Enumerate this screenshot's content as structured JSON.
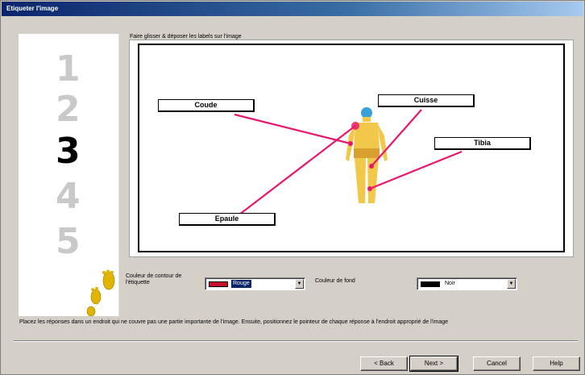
{
  "window": {
    "title": "Etiqueter l'image"
  },
  "steps": [
    "1",
    "2",
    "3",
    "4",
    "5"
  ],
  "current_step": 3,
  "instruction_top": "Faire glisser & déposer les labels sur l'image",
  "labels": [
    "Coude",
    "Cuisse",
    "Tibia",
    "Epaule"
  ],
  "form": {
    "contour_label": "Couleur de contour de l'étiquette",
    "contour_value": "Rouge",
    "contour_color": "#c8102e",
    "fond_label": "Couleur de fond",
    "fond_value": "Noir",
    "fond_color": "#000000"
  },
  "instruction_bottom": "Placez les réponses dans un endroit qui ne couvre pas une partie importante de l'image. Ensuite, positionnez le pointeur de chaque réponse à l'endroit approprié de l'image",
  "buttons": {
    "back": "< Back",
    "next": "Next >",
    "cancel": "Cancel",
    "help": "Help"
  },
  "colors": {
    "pointer_line": "#e8186d",
    "title_bar": "#0a246a",
    "figure_skin": "#f2c84b",
    "figure_head": "#3aa0d8"
  },
  "icons": [
    "footprints-icon",
    "dropdown-arrow-icon"
  ]
}
